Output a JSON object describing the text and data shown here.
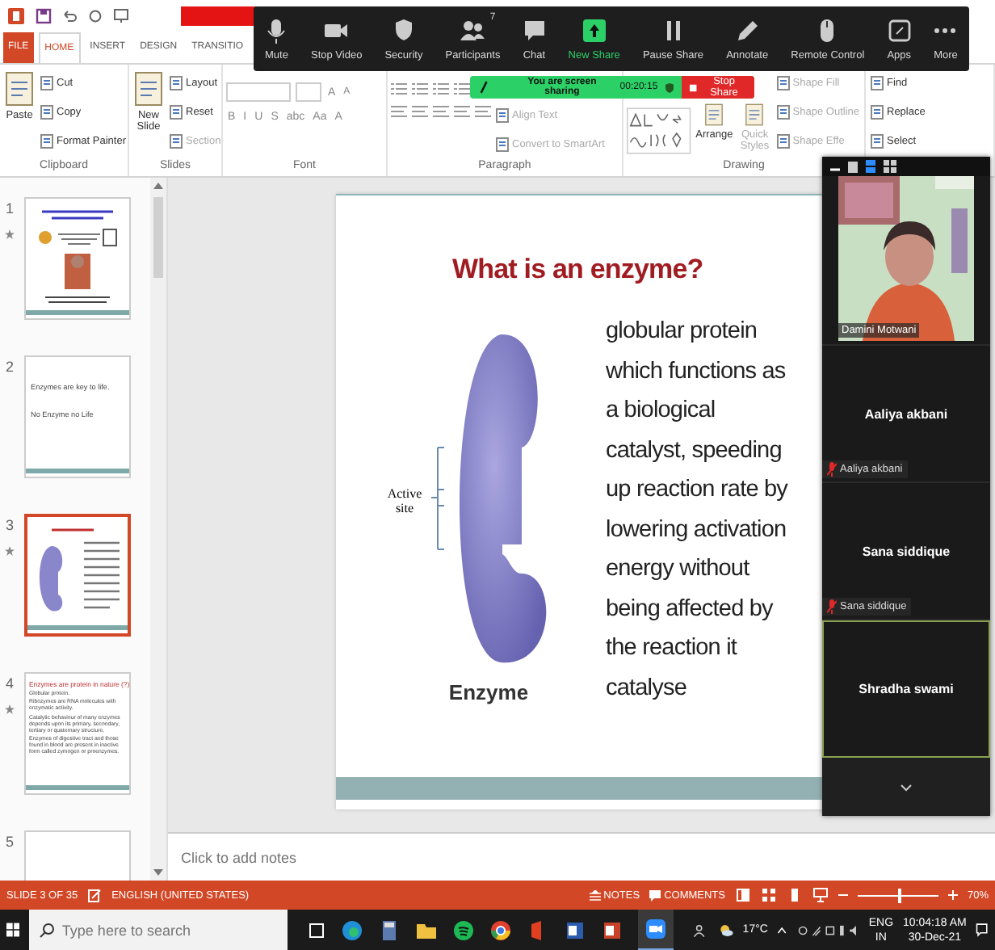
{
  "ribbon": {
    "tabs": [
      {
        "label": "FILE",
        "kind": "file",
        "selected": false
      },
      {
        "label": "HOME",
        "kind": "tab",
        "selected": true
      },
      {
        "label": "INSERT",
        "kind": "tab",
        "selected": false
      },
      {
        "label": "DESIGN",
        "kind": "tab",
        "selected": false
      },
      {
        "label": "TRANSITIO",
        "kind": "tab",
        "selected": false
      }
    ],
    "groups": [
      {
        "label": "Clipboard",
        "items": [
          {
            "kind": "large",
            "label": "Paste",
            "disabled": false
          },
          {
            "kind": "small",
            "label": "Cut",
            "disabled": false
          },
          {
            "kind": "small",
            "label": "Copy",
            "disabled": false
          },
          {
            "kind": "small",
            "label": "Format Painter",
            "disabled": false
          }
        ]
      },
      {
        "label": "Slides",
        "items": [
          {
            "kind": "large",
            "label": "New Slide",
            "disabled": false
          },
          {
            "kind": "small",
            "label": "Layout",
            "disabled": false
          },
          {
            "kind": "small",
            "label": "Reset",
            "disabled": false
          },
          {
            "kind": "small",
            "label": "Section",
            "disabled": true
          }
        ]
      },
      {
        "label": "Font",
        "items": [
          {
            "kind": "font",
            "size_buttons": [
              "A",
              "A"
            ],
            "buttons": [
              "B",
              "I",
              "U",
              "S",
              "abc",
              "Aa",
              "A"
            ]
          }
        ]
      },
      {
        "label": "Paragraph",
        "items": [
          {
            "kind": "paragraph"
          },
          {
            "kind": "small",
            "label": "Align Text",
            "disabled": true
          },
          {
            "kind": "small",
            "label": "Convert to SmartArt",
            "disabled": true
          }
        ]
      },
      {
        "label": "Drawing",
        "items": [
          {
            "kind": "shapes"
          },
          {
            "kind": "large",
            "label": "Arrange",
            "disabled": false
          },
          {
            "kind": "large",
            "label": "Quick Styles",
            "disabled": true
          },
          {
            "kind": "small",
            "label": "Shape Fill",
            "disabled": true
          },
          {
            "kind": "small",
            "label": "Shape Outline",
            "disabled": true
          },
          {
            "kind": "small",
            "label": "Shape Effe",
            "disabled": true
          }
        ]
      },
      {
        "items": [
          {
            "kind": "small",
            "label": "Find",
            "disabled": false
          },
          {
            "kind": "small",
            "label": "Replace",
            "disabled": false
          },
          {
            "kind": "small",
            "label": "Select",
            "disabled": false
          }
        ]
      }
    ]
  },
  "zoom_toolbar": {
    "buttons": [
      {
        "kind": "mic",
        "label": "Mute"
      },
      {
        "kind": "video",
        "label": "Stop Video"
      },
      {
        "kind": "shield",
        "label": "Security"
      },
      {
        "kind": "people",
        "label": "Participants",
        "badge": "7"
      },
      {
        "kind": "chat",
        "label": "Chat"
      },
      {
        "kind": "share",
        "label": "New Share"
      },
      {
        "kind": "pause",
        "label": "Pause Share"
      },
      {
        "kind": "pen",
        "label": "Annotate"
      },
      {
        "kind": "mouse",
        "label": "Remote Control"
      },
      {
        "kind": "apps",
        "label": "Apps"
      },
      {
        "kind": "more",
        "label": "More"
      }
    ]
  },
  "sharing_bar": {
    "message": "You are screen sharing",
    "timer": "00:20:15",
    "stop_label": "Stop Share"
  },
  "thumbnails": [
    {
      "number": "1",
      "kind": "title",
      "starred": true,
      "selected": false
    },
    {
      "number": "2",
      "kind": "text",
      "starred": false,
      "selected": false,
      "lines": [
        "Enzymes are key to life.",
        "No Enzyme no Life"
      ]
    },
    {
      "number": "3",
      "kind": "enzyme",
      "starred": true,
      "selected": true
    },
    {
      "number": "4",
      "kind": "bullets",
      "starred": true,
      "selected": false,
      "title": "Enzymes are protein in nature (?)",
      "lines": [
        "Globular protein.",
        "Ribozymes are RNA molecules with enzymatic activity.",
        "Catalytic behaviour of many enzymes depends upon its primary, secondary, tertiary or quaternary structure.",
        "Enzymes of digestive tract and those found in blood are present in inactive form called zymogen or proenzymes."
      ]
    },
    {
      "number": "5",
      "kind": "blank",
      "starred": false,
      "selected": false
    }
  ],
  "slide": {
    "title": "What is an enzyme?",
    "active_site_label": "Active site",
    "caption": "Enzyme",
    "body": "globular protein\nwhich functions as\na biological\ncatalyst, speeding\nup reaction rate by\nlowering activation\nenergy without\nbeing affected by\nthe reaction it\ncatalyse"
  },
  "notes": {
    "placeholder": "Click to add notes"
  },
  "participants": [
    {
      "kind": "video",
      "name": "Damini Motwani",
      "muted": false,
      "speaking": false
    },
    {
      "kind": "avatar",
      "name": "Aaliya akbani",
      "label": "Aaliya akbani",
      "muted": true,
      "speaking": false
    },
    {
      "kind": "avatar",
      "name": "Sana siddique",
      "label": "Sana siddique",
      "muted": true,
      "speaking": false
    },
    {
      "kind": "avatar",
      "name": "Shradha swami",
      "muted": false,
      "speaking": true
    }
  ],
  "status_bar": {
    "slide_info": "SLIDE 3 OF 35",
    "language": "ENGLISH (UNITED STATES)",
    "notes": "NOTES",
    "comments": "COMMENTS",
    "zoom": {
      "level": 0.5,
      "reading": "70%"
    }
  },
  "taskbar": {
    "search_placeholder": "Type here to search",
    "weather": "17°C",
    "language": "ENG",
    "region": "IN",
    "time": "10:04:18 AM",
    "date": "30-Dec-21"
  }
}
